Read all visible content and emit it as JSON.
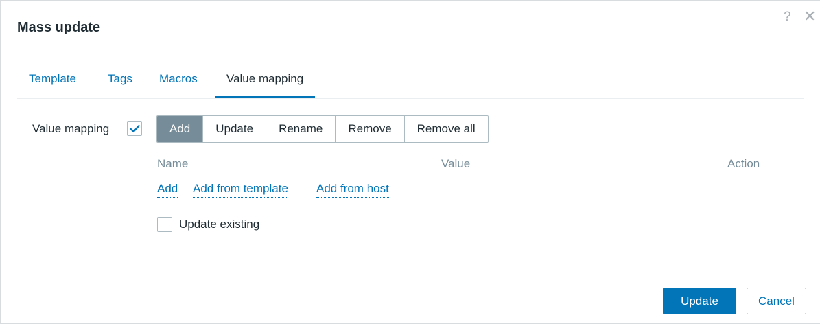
{
  "dialog": {
    "title": "Mass update",
    "help_glyph": "?",
    "close_glyph": "✕"
  },
  "tabs": [
    {
      "label": "Template",
      "active": false
    },
    {
      "label": "Tags",
      "active": false
    },
    {
      "label": "Macros",
      "active": false
    },
    {
      "label": "Value mapping",
      "active": true
    }
  ],
  "value_mapping": {
    "label": "Value mapping",
    "enabled": true,
    "operations": [
      {
        "label": "Add",
        "selected": true
      },
      {
        "label": "Update",
        "selected": false
      },
      {
        "label": "Rename",
        "selected": false
      },
      {
        "label": "Remove",
        "selected": false
      },
      {
        "label": "Remove all",
        "selected": false
      }
    ],
    "columns": {
      "name": "Name",
      "value": "Value",
      "action": "Action"
    },
    "links": {
      "add": "Add",
      "add_from_template": "Add from template",
      "add_from_host": "Add from host"
    },
    "update_existing": {
      "label": "Update existing",
      "checked": false
    }
  },
  "footer": {
    "update_label": "Update",
    "cancel_label": "Cancel"
  },
  "colors": {
    "accent": "#0275b8",
    "selected_segment": "#768d99",
    "muted_text": "#768d99"
  },
  "icons": {
    "help": "question-mark-icon",
    "close": "close-icon",
    "check": "checkmark-icon"
  }
}
